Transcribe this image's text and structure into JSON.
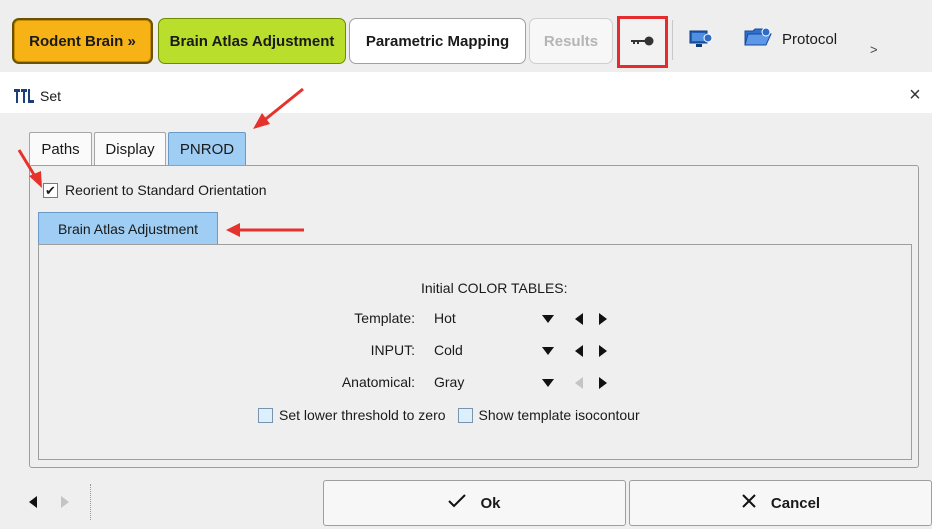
{
  "toolbar": {
    "workflow": {
      "rodent_brain": "Rodent Brain »",
      "brain_atlas_adjustment": "Brain Atlas Adjustment",
      "parametric_mapping": "Parametric Mapping",
      "results": "Results"
    },
    "protocol_label": "Protocol",
    "more": ">",
    "icons": [
      "key-icon",
      "monitor-settings-icon",
      "folder-settings-icon"
    ]
  },
  "dialog": {
    "title": "Set",
    "close": "×",
    "tabs": [
      "Paths",
      "Display",
      "PNROD"
    ],
    "active_tab": "PNROD",
    "reorient": {
      "label": "Reorient to Standard Orientation",
      "checked": true,
      "mark": "✔"
    },
    "inner_tab": "Brain Atlas Adjustment",
    "color_tables": {
      "heading": "Initial COLOR TABLES:",
      "rows": [
        {
          "label": "Template:",
          "value": "Hot"
        },
        {
          "label": "INPUT:",
          "value": "Cold"
        },
        {
          "label": "Anatomical:",
          "value": "Gray"
        }
      ]
    },
    "options": [
      {
        "label": "Set lower threshold to zero",
        "checked": false
      },
      {
        "label": "Show template isocontour",
        "checked": false
      }
    ],
    "buttons": {
      "ok": "Ok",
      "cancel": "Cancel"
    }
  },
  "colors": {
    "rodent_brain": "#f7b315",
    "brain_atlas_adjustment": "#b9de2c",
    "active_tab": "#9fcdf3",
    "highlight": "#e52b2b"
  }
}
